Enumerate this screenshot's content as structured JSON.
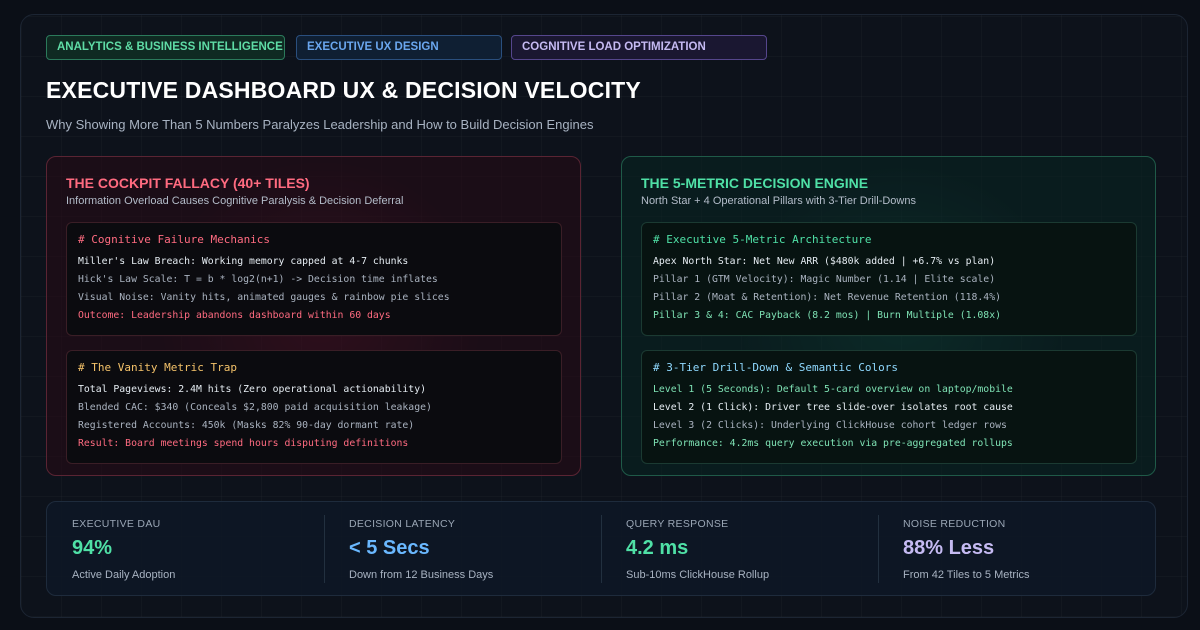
{
  "tags": {
    "t1": "ANALYTICS & BUSINESS INTELLIGENCE",
    "t2": "EXECUTIVE UX DESIGN",
    "t3": "COGNITIVE LOAD OPTIMIZATION"
  },
  "header": {
    "title": "EXECUTIVE DASHBOARD UX & DECISION VELOCITY",
    "subtitle": "Why Showing More Than 5 Numbers Paralyzes Leadership and How to Build Decision Engines"
  },
  "left_panel": {
    "title": "THE COCKPIT FALLACY (40+ TILES)",
    "subtitle": "Information Overload Causes Cognitive Paralysis & Decision Deferral",
    "block1": {
      "heading": "# Cognitive Failure Mechanics",
      "lines": [
        "Miller's Law Breach: Working memory capped at 4-7 chunks",
        "Hick's Law Scale: T = b * log2(n+1) -> Decision time inflates",
        "Visual Noise: Vanity hits, animated gauges & rainbow pie slices",
        "Outcome: Leadership abandons dashboard within 60 days"
      ]
    },
    "block2": {
      "heading": "# The Vanity Metric Trap",
      "lines": [
        "Total Pageviews: 2.4M hits (Zero operational actionability)",
        "Blended CAC: $340 (Conceals $2,800 paid acquisition leakage)",
        "Registered Accounts: 450k (Masks 82% 90-day dormant rate)",
        "Result: Board meetings spend hours disputing definitions"
      ]
    }
  },
  "right_panel": {
    "title": "THE 5-METRIC DECISION ENGINE",
    "subtitle": "North Star + 4 Operational Pillars with 3-Tier Drill-Downs",
    "block1": {
      "heading": "# Executive 5-Metric Architecture",
      "lines": [
        "Apex North Star: Net New ARR ($480k added | +6.7% vs plan)",
        "Pillar 1 (GTM Velocity): Magic Number (1.14 | Elite scale)",
        "Pillar 2 (Moat & Retention): Net Revenue Retention (118.4%)",
        "Pillar 3 & 4: CAC Payback (8.2 mos) | Burn Multiple (1.08x)"
      ]
    },
    "block2": {
      "heading": "# 3-Tier Drill-Down & Semantic Colors",
      "lines": [
        "Level 1 (5 Seconds): Default 5-card overview on laptop/mobile",
        "Level 2 (1 Click): Driver tree slide-over isolates root cause",
        "Level 3 (2 Clicks): Underlying ClickHouse cohort ledger rows",
        "Performance: 4.2ms query execution via pre-aggregated rollups"
      ]
    }
  },
  "stats": [
    {
      "label": "EXECUTIVE DAU",
      "value": "94%",
      "desc": "Active Daily Adoption",
      "color": "#4fe0a6"
    },
    {
      "label": "DECISION LATENCY",
      "value": "< 5 Secs",
      "desc": "Down from 12 Business Days",
      "color": "#6ab8ff"
    },
    {
      "label": "QUERY RESPONSE",
      "value": "4.2 ms",
      "desc": "Sub-10ms ClickHouse Rollup",
      "color": "#4fe0a6"
    },
    {
      "label": "NOISE REDUCTION",
      "value": "88% Less",
      "desc": "From 42 Tiles to 5 Metrics",
      "color": "#c5baf2"
    }
  ]
}
